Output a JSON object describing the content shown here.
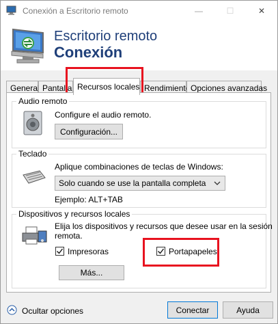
{
  "window": {
    "title": "Conexión a Escritorio remoto",
    "controls": {
      "minimize": "—",
      "maximize": "☐",
      "close": "✕"
    }
  },
  "banner": {
    "line1": "Escritorio remoto",
    "line2": "Conexión"
  },
  "tabs": [
    {
      "label": "General",
      "active": false
    },
    {
      "label": "Pantalla",
      "active": false
    },
    {
      "label": "Recursos locales",
      "active": true
    },
    {
      "label": "Rendimiento",
      "active": false
    },
    {
      "label": "Opciones avanzadas",
      "active": false
    }
  ],
  "audio": {
    "group_title": "Audio remoto",
    "description": "Configure el audio remoto.",
    "button": "Configuración..."
  },
  "keyboard": {
    "group_title": "Teclado",
    "description": "Aplique combinaciones de teclas de Windows:",
    "select_value": "Solo cuando se use la pantalla completa",
    "example": "Ejemplo: ALT+TAB"
  },
  "devices": {
    "group_title": "Dispositivos y recursos locales",
    "description_line1": "Elija los dispositivos y recursos que desee usar en la sesión",
    "description_line2": "remota.",
    "printers_label": "Impresoras",
    "printers_checked": true,
    "clipboard_label": "Portapapeles",
    "clipboard_checked": true,
    "more_button": "Más..."
  },
  "footer": {
    "toggle_label": "Ocultar opciones",
    "connect_button": "Conectar",
    "help_button": "Ayuda"
  },
  "colors": {
    "accent_title": "#1f3f79",
    "highlight": "#e8121f"
  }
}
